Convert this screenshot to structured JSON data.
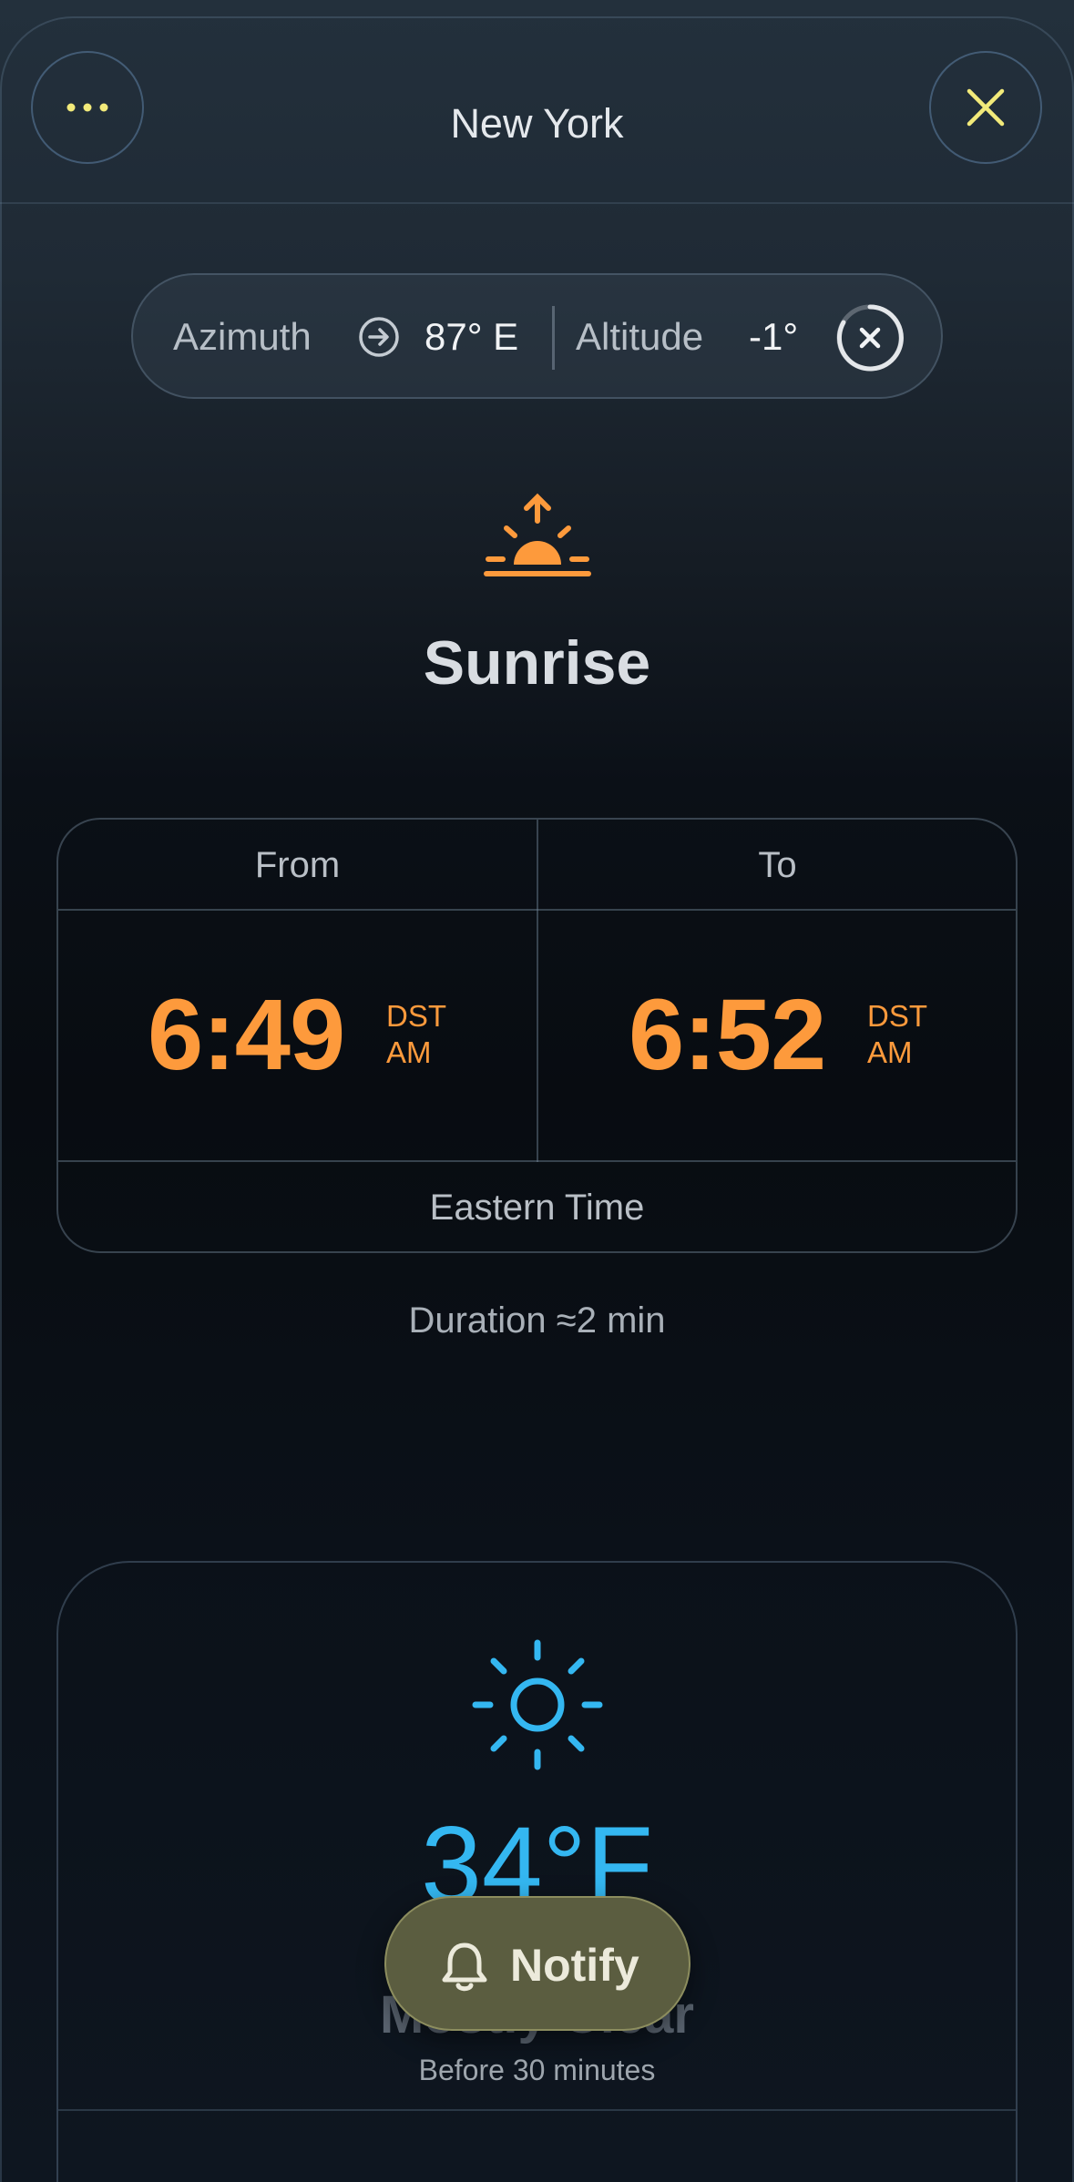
{
  "header": {
    "title": "New York",
    "more_icon": "more-horizontal-icon",
    "close_icon": "close-icon",
    "accent_color": "#f2ea7a"
  },
  "sun_position": {
    "azimuth_label": "Azimuth",
    "azimuth_value": "87° E",
    "altitude_label": "Altitude",
    "altitude_value": "-1°"
  },
  "event": {
    "icon": "sunrise-icon",
    "title": "Sunrise",
    "from_label": "From",
    "to_label": "To",
    "from_time": "6:49",
    "from_dst": "DST",
    "from_ampm": "AM",
    "to_time": "6:52",
    "to_dst": "DST",
    "to_ampm": "AM",
    "timezone": "Eastern Time",
    "duration": "Duration ≈2 min",
    "time_color": "#fd9a3c"
  },
  "weather": {
    "icon": "sun-icon",
    "temperature": "34°F",
    "condition": "Mostly Clear",
    "before": "Before 30 minutes",
    "temp_color": "#34b7f1"
  },
  "notify_button": {
    "label": "Notify",
    "icon": "bell-icon"
  }
}
